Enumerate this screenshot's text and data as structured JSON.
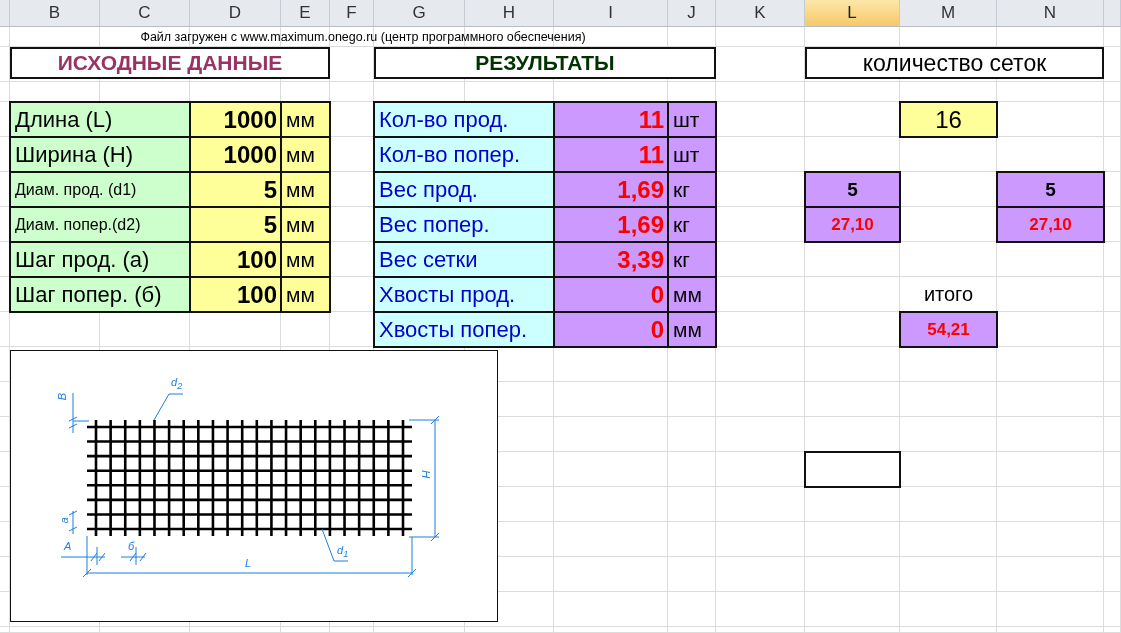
{
  "column_headers": [
    {
      "label": "B",
      "selected": false
    },
    {
      "label": "C",
      "selected": false
    },
    {
      "label": "D",
      "selected": false
    },
    {
      "label": "E",
      "selected": false
    },
    {
      "label": "F",
      "selected": false
    },
    {
      "label": "G",
      "selected": false
    },
    {
      "label": "H",
      "selected": false
    },
    {
      "label": "I",
      "selected": false
    },
    {
      "label": "J",
      "selected": false
    },
    {
      "label": "K",
      "selected": false
    },
    {
      "label": "L",
      "selected": true
    },
    {
      "label": "M",
      "selected": false
    },
    {
      "label": "N",
      "selected": false
    }
  ],
  "note": "Файл загружен с www.maximum.onego.ru (центр программного обеспечения)",
  "input_title": "ИСХОДНЫЕ ДАННЫЕ",
  "results_title": "РЕЗУЛЬТАТЫ",
  "count_title": "количество сеток",
  "inputs": [
    {
      "label": "Длина (L)",
      "value": "1000",
      "unit": "мм"
    },
    {
      "label": "Ширина (H)",
      "value": "1000",
      "unit": "мм"
    },
    {
      "label": "Диам. прод. (d1)",
      "value": "5",
      "unit": "мм"
    },
    {
      "label": "Диам. попер.(d2)",
      "value": "5",
      "unit": "мм"
    },
    {
      "label": "Шаг прод. (а)",
      "value": "100",
      "unit": "мм"
    },
    {
      "label": "Шаг попер. (б)",
      "value": "100",
      "unit": "мм"
    }
  ],
  "results": [
    {
      "label": "Кол-во прод.",
      "value": "11",
      "unit": "шт"
    },
    {
      "label": "Кол-во попер.",
      "value": "11",
      "unit": "шт"
    },
    {
      "label": "Вес прод.",
      "value": "1,69",
      "unit": "кг"
    },
    {
      "label": "Вес попер.",
      "value": "1,69",
      "unit": "кг"
    },
    {
      "label": "Вес сетки",
      "value": "3,39",
      "unit": "кг"
    },
    {
      "label": "Хвосты прод.",
      "value": "0",
      "unit": "мм"
    },
    {
      "label": "Хвосты попер.",
      "value": "0",
      "unit": "мм"
    }
  ],
  "count": {
    "value": "16",
    "columns": [
      {
        "pieces": "5",
        "weight": "27,10"
      },
      {
        "pieces": "5",
        "weight": "27,10"
      }
    ],
    "total_label": "итого",
    "total": "54,21"
  },
  "drawing": {
    "labels": [
      "d$_{2}$",
      "d$_{1}$",
      "B",
      "a",
      "A",
      "б",
      "L",
      "H"
    ]
  }
}
